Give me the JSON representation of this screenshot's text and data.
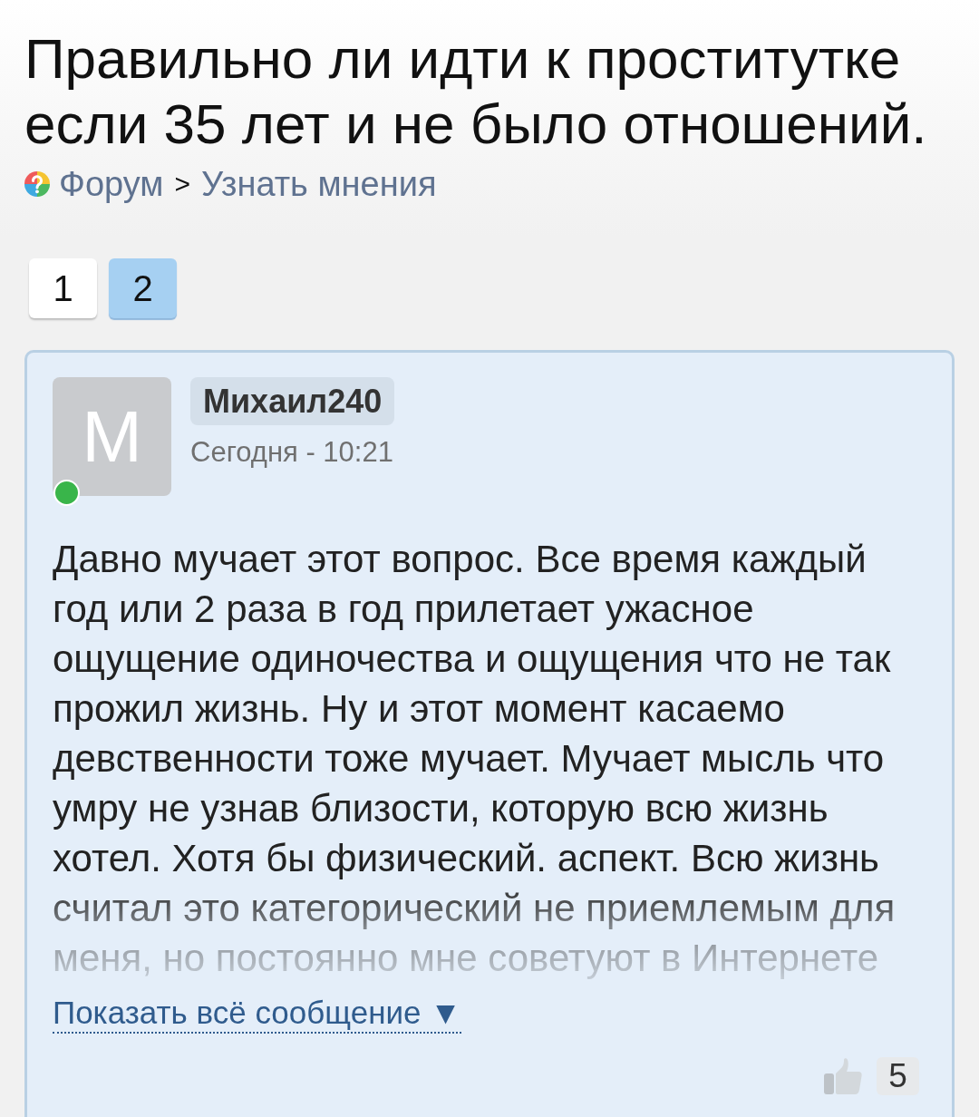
{
  "title": "Правильно ли идти к проститутке если 35 лет и не было отношений.",
  "breadcrumb": {
    "items": [
      {
        "label": "Форум"
      },
      {
        "label": "Узнать мнения"
      }
    ],
    "separator": ">"
  },
  "pagination": [
    {
      "label": "1",
      "selected": false
    },
    {
      "label": "2",
      "selected": true
    }
  ],
  "post": {
    "author": {
      "initial": "M",
      "name": "Михаил240",
      "online": true
    },
    "time": "Сегодня - 10:21",
    "text": "Давно мучает этот вопрос. Все время каждый год или 2 раза в год прилетает ужасное ощущение одиночества и ощущения что не так прожил жизнь. Ну и этот момент касаемо девственности тоже мучает. Мучает мысль что умру не узнав близости, которую всю жизнь хотел. Хотя бы физический. аспект. Всю жизнь считал это категорический не приемлемым для меня, но постоянно мне советуют в Интернете",
    "show_more": "Показать всё сообщение ▼",
    "likes": "5"
  }
}
